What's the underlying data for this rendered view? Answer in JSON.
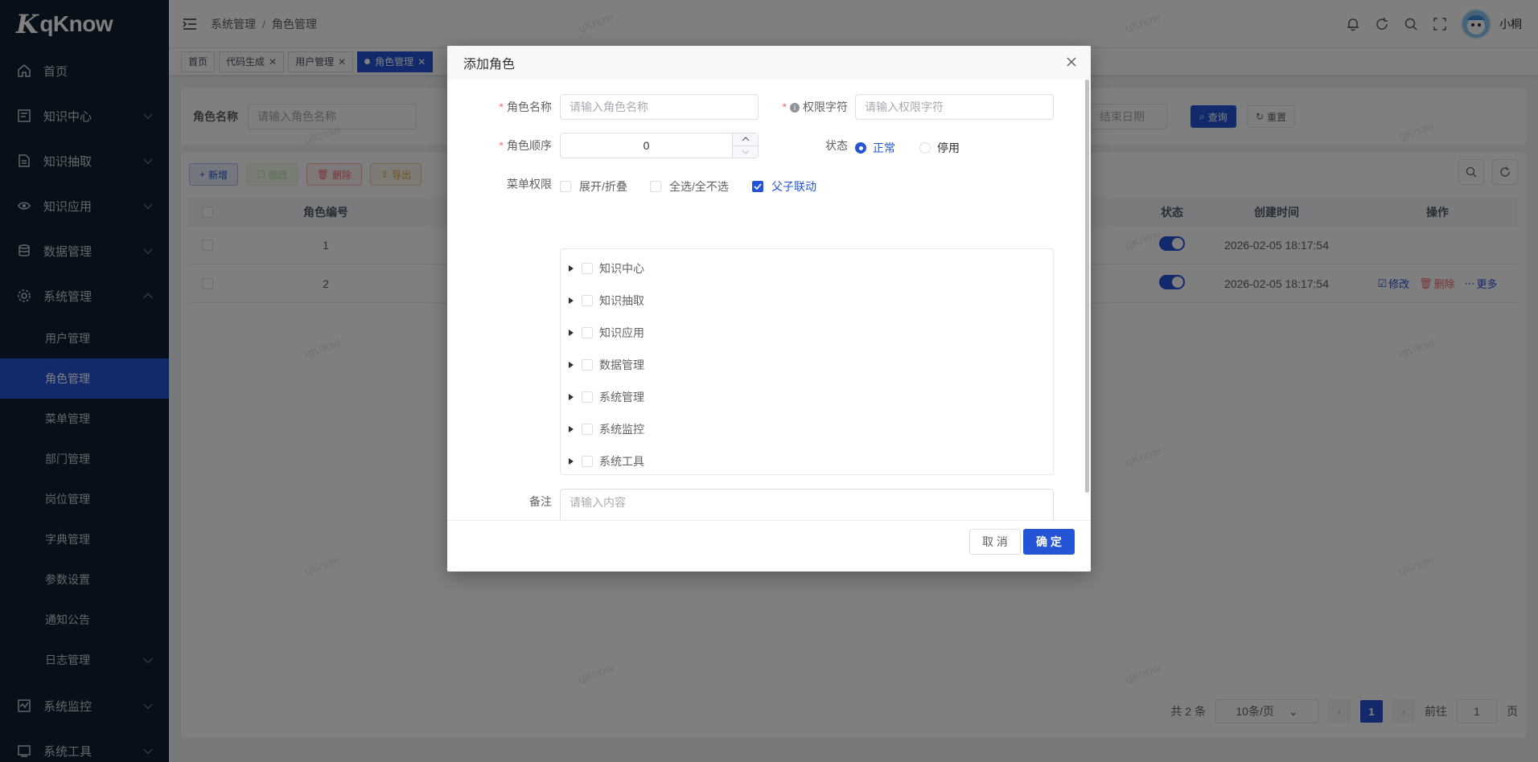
{
  "app": {
    "logo_text": "qKnow",
    "user_name": "小桐"
  },
  "sidebar": {
    "items": [
      {
        "label": "首页",
        "icon": "home-icon"
      },
      {
        "label": "知识中心",
        "icon": "book-icon"
      },
      {
        "label": "知识抽取",
        "icon": "document-icon"
      },
      {
        "label": "知识应用",
        "icon": "app-icon"
      },
      {
        "label": "数据管理",
        "icon": "database-icon"
      },
      {
        "label": "系统管理",
        "icon": "gear-icon"
      }
    ],
    "sub_items": [
      {
        "label": "用户管理"
      },
      {
        "label": "角色管理"
      },
      {
        "label": "菜单管理"
      },
      {
        "label": "部门管理"
      },
      {
        "label": "岗位管理"
      },
      {
        "label": "字典管理"
      },
      {
        "label": "参数设置"
      },
      {
        "label": "通知公告"
      },
      {
        "label": "日志管理"
      }
    ],
    "tail_items": [
      {
        "label": "系统监控",
        "icon": "monitor-icon"
      },
      {
        "label": "系统工具",
        "icon": "tools-icon"
      }
    ]
  },
  "header": {
    "breadcrumb": [
      "系统管理",
      "角色管理"
    ],
    "breadcrumb_sep": "/"
  },
  "tags": [
    "首页",
    "代码生成",
    "用户管理",
    "角色管理"
  ],
  "search": {
    "role_name_label": "角色名称",
    "role_name_placeholder": "请输入角色名称",
    "end_date_placeholder": "结束日期",
    "query_label": "查询",
    "reset_label": "重置"
  },
  "toolbar": {
    "add": "新增",
    "edit": "修改",
    "delete": "删除",
    "export": "导出"
  },
  "table": {
    "headers": {
      "id": "角色编号",
      "state": "状态",
      "created": "创建时间",
      "ops": "操作"
    },
    "rows": [
      {
        "id": "1",
        "created": "2026-02-05 18:17:54"
      },
      {
        "id": "2",
        "created": "2026-02-05 18:17:54"
      }
    ],
    "ops": {
      "edit": "修改",
      "delete": "删除",
      "more": "更多"
    }
  },
  "pagination": {
    "total": "共 2 条",
    "page_size": "10条/页",
    "current": "1",
    "goto_label": "前往",
    "goto_value": "1",
    "page_unit": "页"
  },
  "watermark": "qKnow",
  "dialog": {
    "title": "添加角色",
    "role_name_label": "角色名称",
    "role_name_placeholder": "请输入角色名称",
    "perm_label": "权限字符",
    "perm_placeholder": "请输入权限字符",
    "order_label": "角色顺序",
    "order_value": "0",
    "status_label": "状态",
    "status_normal": "正常",
    "status_disabled": "停用",
    "menu_perm_label": "菜单权限",
    "expand_label": "展开/折叠",
    "select_all_label": "全选/全不选",
    "linkage_label": "父子联动",
    "tree": [
      "知识中心",
      "知识抽取",
      "知识应用",
      "数据管理",
      "系统管理",
      "系统监控",
      "系统工具"
    ],
    "remark_label": "备注",
    "remark_placeholder": "请输入内容",
    "cancel": "取 消",
    "confirm": "确 定"
  },
  "colors": {
    "primary": "#2455d6",
    "sidebar_bg": "#0f1f33",
    "danger": "#f56c6c"
  }
}
